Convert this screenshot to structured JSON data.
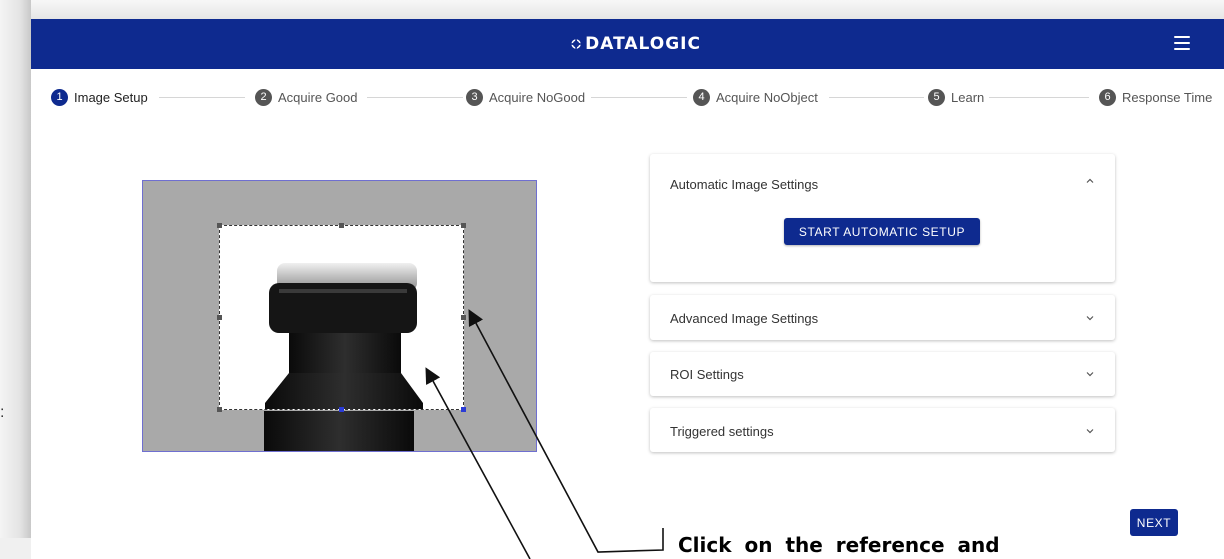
{
  "header": {
    "logo_text": "DATALOGIC",
    "brand_color": "#0e2a8f"
  },
  "stepper": {
    "steps": [
      {
        "number": "1",
        "label": "Image Setup",
        "active": true
      },
      {
        "number": "2",
        "label": "Acquire Good",
        "active": false
      },
      {
        "number": "3",
        "label": "Acquire NoGood",
        "active": false
      },
      {
        "number": "4",
        "label": "Acquire NoObject",
        "active": false
      },
      {
        "number": "5",
        "label": "Learn",
        "active": false
      },
      {
        "number": "6",
        "label": "Response Time",
        "active": false
      }
    ]
  },
  "settings": {
    "automatic": {
      "title": "Automatic Image Settings",
      "button": "START AUTOMATIC SETUP",
      "expanded": true
    },
    "advanced": {
      "title": "Advanced Image Settings",
      "expanded": false
    },
    "roi": {
      "title": "ROI Settings",
      "expanded": false
    },
    "triggered": {
      "title": "Triggered settings",
      "expanded": false
    }
  },
  "actions": {
    "next_label": "NEXT"
  },
  "annotation": {
    "callout_text": "Click on the reference and"
  },
  "icons": {
    "menu": "hamburger-menu-icon",
    "expand": "chevron-down-icon",
    "collapse": "chevron-up-icon",
    "logo": "datalogic-logo-icon"
  },
  "colors": {
    "accent": "#0e2a8f",
    "step_inactive": "#555555",
    "image_background": "#a9a9a9"
  }
}
